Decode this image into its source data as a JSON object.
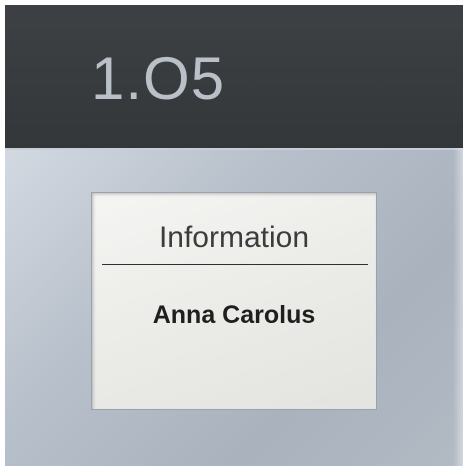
{
  "sign": {
    "room_number": "1.O5",
    "display": {
      "title": "Information",
      "name": "Anna Carolus"
    }
  },
  "colors": {
    "header": "#33373a",
    "room_number_text": "#b9c0c8",
    "plate": "#b4bcc7",
    "display_background": "#ecece9",
    "display_text": "#1f1f1f"
  }
}
